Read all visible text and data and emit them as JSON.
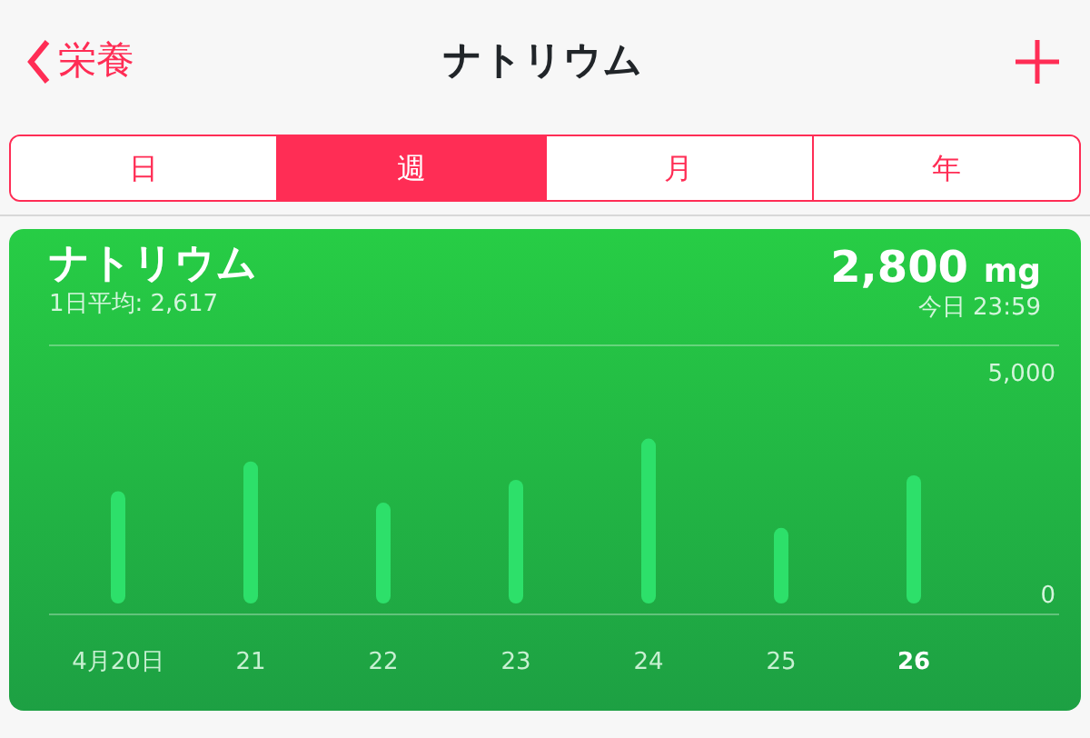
{
  "nav": {
    "back_label": "栄養",
    "title": "ナトリウム"
  },
  "tabs": [
    {
      "label": "日",
      "selected": false
    },
    {
      "label": "週",
      "selected": true
    },
    {
      "label": "月",
      "selected": false
    },
    {
      "label": "年",
      "selected": false
    }
  ],
  "card": {
    "title": "ナトリウム",
    "subtitle": "1日平均: 2,617",
    "value": "2,800",
    "unit": "mg",
    "time": "今日 23:59",
    "day_labels": [
      {
        "selected": false
      },
      {
        "selected": false
      },
      {
        "selected": false
      },
      {
        "selected": false
      },
      {
        "selected": false
      },
      {
        "selected": false
      },
      {
        "selected": true
      }
    ],
    "chart_data": {
      "type": "bar",
      "categories": [
        "4月20日",
        "21",
        "22",
        "23",
        "24",
        "25",
        "26"
      ],
      "series": [
        {
          "color": "#2de06a",
          "values": [
            2450,
            3100,
            2200,
            2700,
            3600,
            1650,
            2800
          ]
        }
      ],
      "ylim": [
        0,
        5000
      ],
      "yticks": [
        {
          "value": 5000,
          "label": "5,000"
        },
        {
          "value": 0,
          "label": "0"
        }
      ]
    }
  }
}
